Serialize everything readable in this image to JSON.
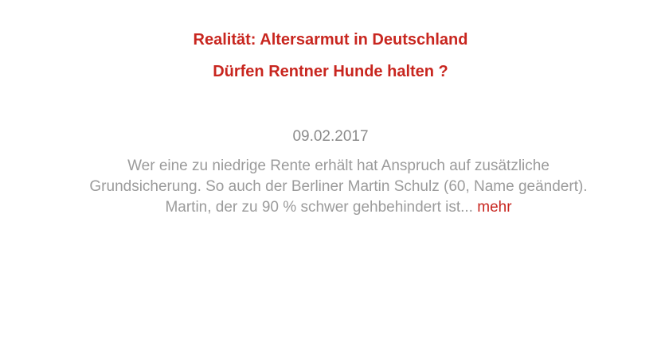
{
  "article": {
    "headline_line1": "Realität: Altersarmut in Deutschland",
    "headline_line2": "Dürfen Rentner Hunde halten ?",
    "date": "09.02.2017",
    "teaser": "Wer eine zu niedrige Rente erhält hat Anspruch auf zusätzliche Grundsicherung. So auch der Berliner Martin Schulz (60, Name geändert). Martin, der zu 90 % schwer gehbehindert ist...",
    "more_label": "mehr"
  },
  "colors": {
    "accent": "#c8261f",
    "text_muted": "#9b9b9b",
    "background": "#ffffff"
  }
}
